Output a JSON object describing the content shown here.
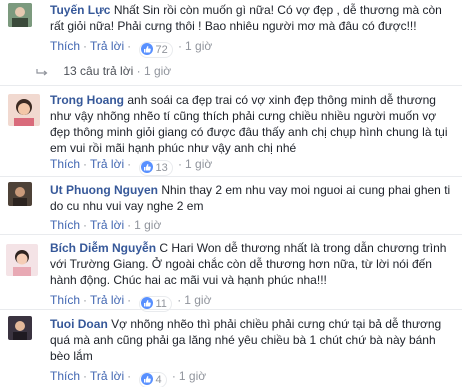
{
  "comments": [
    {
      "name": "Tuyến Lực",
      "text": "Nhất Sin rồi còn muốn gì nữa! Có vợ đẹp , dễ thương mà còn rất giỏi nữa! Phải cưng thôi ! Bao nhiêu người mơ mà đâu có được!!!",
      "like_label": "Thích",
      "reply_label": "Trả lời",
      "reactions": "72",
      "time": "1 giờ"
    },
    {
      "name": "Trong Hoang",
      "text": "anh soái ca đẹp trai có vợ xinh đẹp thông minh dễ thương như vậy nhõng nhẽo tí cũng thích phải cưng chiều nhiều người muốn vợ đẹp thông minh giỏi giang có được đâu thấy anh chị chụp hình chung là tụi em vui rồi mãi hạnh phúc như vậy anh chị nhé",
      "like_label": "Thích",
      "reply_label": "Trả lời",
      "reactions": "13",
      "time": "1 giờ"
    },
    {
      "name": "Ut Phuong Nguyen",
      "text": "Nhin thay 2 em nhu vay moi nguoi ai cung phai ghen ti do cu nhu vui vay nghe 2 em",
      "like_label": "Thích",
      "reply_label": "Trả lời",
      "reactions": "",
      "time": "1 giờ"
    },
    {
      "name": "Bích Diễm Nguyễn",
      "text": "C Hari Won dễ thương nhất là trong dẫn chương trình với Trường Giang. Ở ngoài chắc còn dễ thương hơn nữa, từ lời nói đến hành động. Chúc hai ac mãi vui và hạnh phúc nha!!!",
      "like_label": "Thích",
      "reply_label": "Trả lời",
      "reactions": "11",
      "time": "1 giờ"
    },
    {
      "name": "Tuoi Doan",
      "text": "Vợ nhõng nhẽo thì phải chiều phải cưng chứ tại bả dễ thương quá mà anh cũng phải ga lăng nhé yêu chiều bà 1 chút chứ bà này bánh bèo lắm",
      "like_label": "Thích",
      "reply_label": "Trả lời",
      "reactions": "4",
      "time": "1 giờ"
    }
  ],
  "replies_summary": {
    "count_label": "13 câu trả lời",
    "separator": "·",
    "time": "1 giờ"
  },
  "colors": {
    "name": "#365899",
    "link": "#4267b2",
    "meta": "#90949c",
    "like_blue": "#5890ff"
  }
}
